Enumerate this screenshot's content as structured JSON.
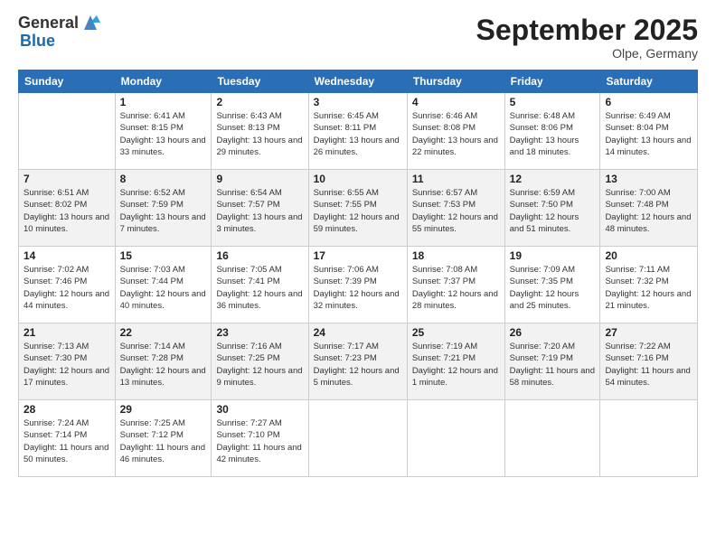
{
  "header": {
    "logo_general": "General",
    "logo_blue": "Blue",
    "month_title": "September 2025",
    "location": "Olpe, Germany"
  },
  "columns": [
    "Sunday",
    "Monday",
    "Tuesday",
    "Wednesday",
    "Thursday",
    "Friday",
    "Saturday"
  ],
  "weeks": [
    [
      {
        "day": "",
        "sunrise": "",
        "sunset": "",
        "daylight": ""
      },
      {
        "day": "1",
        "sunrise": "Sunrise: 6:41 AM",
        "sunset": "Sunset: 8:15 PM",
        "daylight": "Daylight: 13 hours and 33 minutes."
      },
      {
        "day": "2",
        "sunrise": "Sunrise: 6:43 AM",
        "sunset": "Sunset: 8:13 PM",
        "daylight": "Daylight: 13 hours and 29 minutes."
      },
      {
        "day": "3",
        "sunrise": "Sunrise: 6:45 AM",
        "sunset": "Sunset: 8:11 PM",
        "daylight": "Daylight: 13 hours and 26 minutes."
      },
      {
        "day": "4",
        "sunrise": "Sunrise: 6:46 AM",
        "sunset": "Sunset: 8:08 PM",
        "daylight": "Daylight: 13 hours and 22 minutes."
      },
      {
        "day": "5",
        "sunrise": "Sunrise: 6:48 AM",
        "sunset": "Sunset: 8:06 PM",
        "daylight": "Daylight: 13 hours and 18 minutes."
      },
      {
        "day": "6",
        "sunrise": "Sunrise: 6:49 AM",
        "sunset": "Sunset: 8:04 PM",
        "daylight": "Daylight: 13 hours and 14 minutes."
      }
    ],
    [
      {
        "day": "7",
        "sunrise": "Sunrise: 6:51 AM",
        "sunset": "Sunset: 8:02 PM",
        "daylight": "Daylight: 13 hours and 10 minutes."
      },
      {
        "day": "8",
        "sunrise": "Sunrise: 6:52 AM",
        "sunset": "Sunset: 7:59 PM",
        "daylight": "Daylight: 13 hours and 7 minutes."
      },
      {
        "day": "9",
        "sunrise": "Sunrise: 6:54 AM",
        "sunset": "Sunset: 7:57 PM",
        "daylight": "Daylight: 13 hours and 3 minutes."
      },
      {
        "day": "10",
        "sunrise": "Sunrise: 6:55 AM",
        "sunset": "Sunset: 7:55 PM",
        "daylight": "Daylight: 12 hours and 59 minutes."
      },
      {
        "day": "11",
        "sunrise": "Sunrise: 6:57 AM",
        "sunset": "Sunset: 7:53 PM",
        "daylight": "Daylight: 12 hours and 55 minutes."
      },
      {
        "day": "12",
        "sunrise": "Sunrise: 6:59 AM",
        "sunset": "Sunset: 7:50 PM",
        "daylight": "Daylight: 12 hours and 51 minutes."
      },
      {
        "day": "13",
        "sunrise": "Sunrise: 7:00 AM",
        "sunset": "Sunset: 7:48 PM",
        "daylight": "Daylight: 12 hours and 48 minutes."
      }
    ],
    [
      {
        "day": "14",
        "sunrise": "Sunrise: 7:02 AM",
        "sunset": "Sunset: 7:46 PM",
        "daylight": "Daylight: 12 hours and 44 minutes."
      },
      {
        "day": "15",
        "sunrise": "Sunrise: 7:03 AM",
        "sunset": "Sunset: 7:44 PM",
        "daylight": "Daylight: 12 hours and 40 minutes."
      },
      {
        "day": "16",
        "sunrise": "Sunrise: 7:05 AM",
        "sunset": "Sunset: 7:41 PM",
        "daylight": "Daylight: 12 hours and 36 minutes."
      },
      {
        "day": "17",
        "sunrise": "Sunrise: 7:06 AM",
        "sunset": "Sunset: 7:39 PM",
        "daylight": "Daylight: 12 hours and 32 minutes."
      },
      {
        "day": "18",
        "sunrise": "Sunrise: 7:08 AM",
        "sunset": "Sunset: 7:37 PM",
        "daylight": "Daylight: 12 hours and 28 minutes."
      },
      {
        "day": "19",
        "sunrise": "Sunrise: 7:09 AM",
        "sunset": "Sunset: 7:35 PM",
        "daylight": "Daylight: 12 hours and 25 minutes."
      },
      {
        "day": "20",
        "sunrise": "Sunrise: 7:11 AM",
        "sunset": "Sunset: 7:32 PM",
        "daylight": "Daylight: 12 hours and 21 minutes."
      }
    ],
    [
      {
        "day": "21",
        "sunrise": "Sunrise: 7:13 AM",
        "sunset": "Sunset: 7:30 PM",
        "daylight": "Daylight: 12 hours and 17 minutes."
      },
      {
        "day": "22",
        "sunrise": "Sunrise: 7:14 AM",
        "sunset": "Sunset: 7:28 PM",
        "daylight": "Daylight: 12 hours and 13 minutes."
      },
      {
        "day": "23",
        "sunrise": "Sunrise: 7:16 AM",
        "sunset": "Sunset: 7:25 PM",
        "daylight": "Daylight: 12 hours and 9 minutes."
      },
      {
        "day": "24",
        "sunrise": "Sunrise: 7:17 AM",
        "sunset": "Sunset: 7:23 PM",
        "daylight": "Daylight: 12 hours and 5 minutes."
      },
      {
        "day": "25",
        "sunrise": "Sunrise: 7:19 AM",
        "sunset": "Sunset: 7:21 PM",
        "daylight": "Daylight: 12 hours and 1 minute."
      },
      {
        "day": "26",
        "sunrise": "Sunrise: 7:20 AM",
        "sunset": "Sunset: 7:19 PM",
        "daylight": "Daylight: 11 hours and 58 minutes."
      },
      {
        "day": "27",
        "sunrise": "Sunrise: 7:22 AM",
        "sunset": "Sunset: 7:16 PM",
        "daylight": "Daylight: 11 hours and 54 minutes."
      }
    ],
    [
      {
        "day": "28",
        "sunrise": "Sunrise: 7:24 AM",
        "sunset": "Sunset: 7:14 PM",
        "daylight": "Daylight: 11 hours and 50 minutes."
      },
      {
        "day": "29",
        "sunrise": "Sunrise: 7:25 AM",
        "sunset": "Sunset: 7:12 PM",
        "daylight": "Daylight: 11 hours and 46 minutes."
      },
      {
        "day": "30",
        "sunrise": "Sunrise: 7:27 AM",
        "sunset": "Sunset: 7:10 PM",
        "daylight": "Daylight: 11 hours and 42 minutes."
      },
      {
        "day": "",
        "sunrise": "",
        "sunset": "",
        "daylight": ""
      },
      {
        "day": "",
        "sunrise": "",
        "sunset": "",
        "daylight": ""
      },
      {
        "day": "",
        "sunrise": "",
        "sunset": "",
        "daylight": ""
      },
      {
        "day": "",
        "sunrise": "",
        "sunset": "",
        "daylight": ""
      }
    ]
  ]
}
